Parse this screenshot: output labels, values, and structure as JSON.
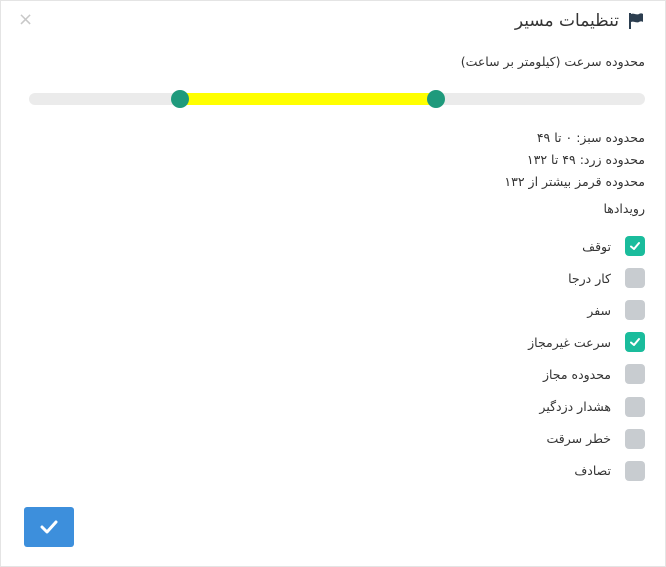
{
  "dialog": {
    "title": "تنظیمات مسیر",
    "close_symbol": "×",
    "title_icon": "flag-icon",
    "close_icon": "close-icon"
  },
  "speed": {
    "label": "محدوده سرعت (کیلومتر بر ساعت)",
    "range_low_fraction": 0.245,
    "range_high_fraction": 0.66,
    "fill_color": "#ffff00",
    "track_color": "#ebebeb",
    "handle_color": "#1f9a7c",
    "green_range": "محدوده سبز: ۰ تا ۴۹",
    "yellow_range": "محدوده زرد: ۴۹ تا ۱۳۲",
    "red_range": "محدوده قرمز بیشتر از ۱۳۲"
  },
  "events": {
    "heading": "رویدادها",
    "items": [
      {
        "label": "توقف",
        "checked": true
      },
      {
        "label": "کار درجا",
        "checked": false
      },
      {
        "label": "سفر",
        "checked": false
      },
      {
        "label": "سرعت غیرمجاز",
        "checked": true
      },
      {
        "label": "محدوده مجاز",
        "checked": false
      },
      {
        "label": "هشدار دزدگیر",
        "checked": false
      },
      {
        "label": "خطر سرقت",
        "checked": false
      },
      {
        "label": "تصادف",
        "checked": false
      }
    ]
  },
  "confirm": {
    "icon": "check-icon",
    "color": "#3d8fdc"
  },
  "colors": {
    "checked": "#1abc9c",
    "unchecked": "#c8ccd0"
  }
}
